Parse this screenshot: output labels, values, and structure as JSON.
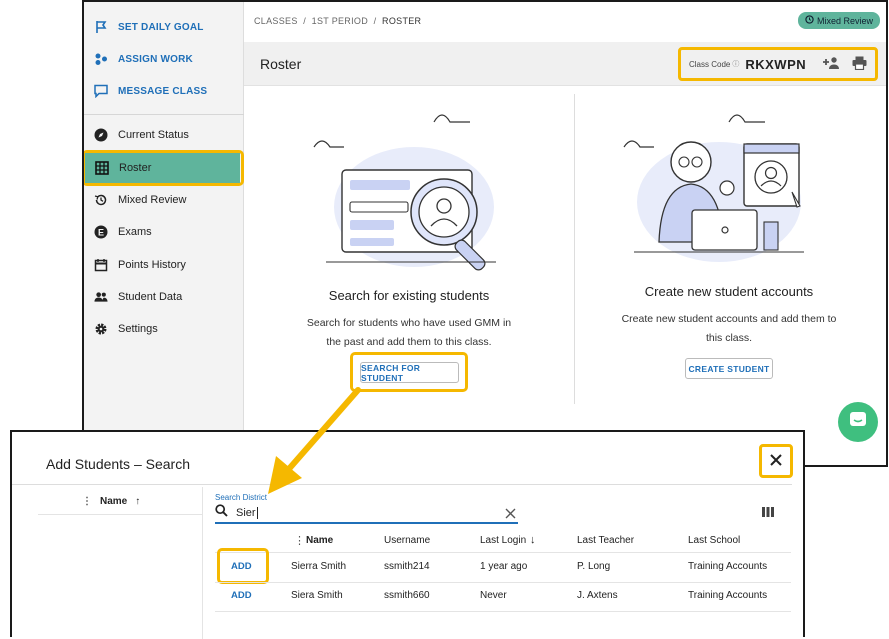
{
  "sidebar": {
    "primary": [
      {
        "label": "SET DAILY GOAL",
        "icon": "flag-icon"
      },
      {
        "label": "ASSIGN WORK",
        "icon": "assign-icon"
      },
      {
        "label": "MESSAGE CLASS",
        "icon": "message-icon"
      }
    ],
    "items": [
      {
        "label": "Current Status",
        "icon": "compass-icon"
      },
      {
        "label": "Roster",
        "icon": "grid-icon"
      },
      {
        "label": "Mixed Review",
        "icon": "history-icon"
      },
      {
        "label": "Exams",
        "icon": "exam-icon"
      },
      {
        "label": "Points History",
        "icon": "calendar-icon"
      },
      {
        "label": "Student Data",
        "icon": "people-icon"
      },
      {
        "label": "Settings",
        "icon": "gear-icon"
      }
    ]
  },
  "breadcrumb": {
    "a": "CLASSES",
    "sep": "/",
    "b": "1ST PERIOD",
    "c": "ROSTER"
  },
  "badge": "Mixed Review",
  "roster": {
    "title": "Roster",
    "class_code_label": "Class Code",
    "class_code": "RKXWPN"
  },
  "search_card": {
    "title": "Search for existing students",
    "line1": "Search for students who have used GMM in",
    "line2": "the past and add them to this class.",
    "button": "SEARCH FOR STUDENT"
  },
  "create_card": {
    "title": "Create new student accounts",
    "line1": "Create new student accounts and add them to",
    "line2": "this class.",
    "button": "CREATE STUDENT"
  },
  "dialog": {
    "title": "Add Students – Search",
    "left_col": "Name",
    "search_label": "Search District",
    "search_value": "Sier",
    "columns": [
      "Name",
      "Username",
      "Last Login",
      "Last Teacher",
      "Last School"
    ],
    "add_label": "ADD",
    "rows": [
      {
        "name": "Sierra Smith",
        "username": "ssmith214",
        "last_login": "1 year ago",
        "teacher": "P. Long",
        "school": "Training Accounts"
      },
      {
        "name": "Siera Smith",
        "username": "ssmith660",
        "last_login": "Never",
        "teacher": "J. Axtens",
        "school": "Training Accounts"
      }
    ]
  },
  "colors": {
    "accent": "#1f6fb8",
    "highlight": "#f5b800",
    "badge": "#5fb49c",
    "roster_active": "#5fb49c"
  }
}
